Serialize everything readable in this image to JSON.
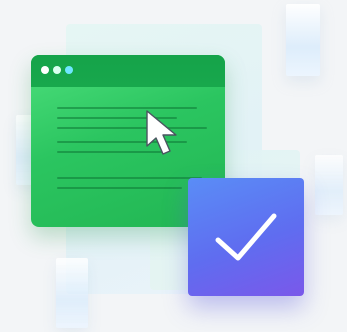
{
  "illustration": {
    "icons": {
      "window": "browser-window-icon",
      "cursor": "mouse-cursor-icon",
      "check": "checkmark-icon"
    },
    "colors": {
      "background": "#f3f5f7",
      "window_green": "#2bc560",
      "titlebar_green": "#15a34a",
      "check_card_blue": "#5f6df0",
      "check_card_purple": "#7a58ea"
    }
  }
}
